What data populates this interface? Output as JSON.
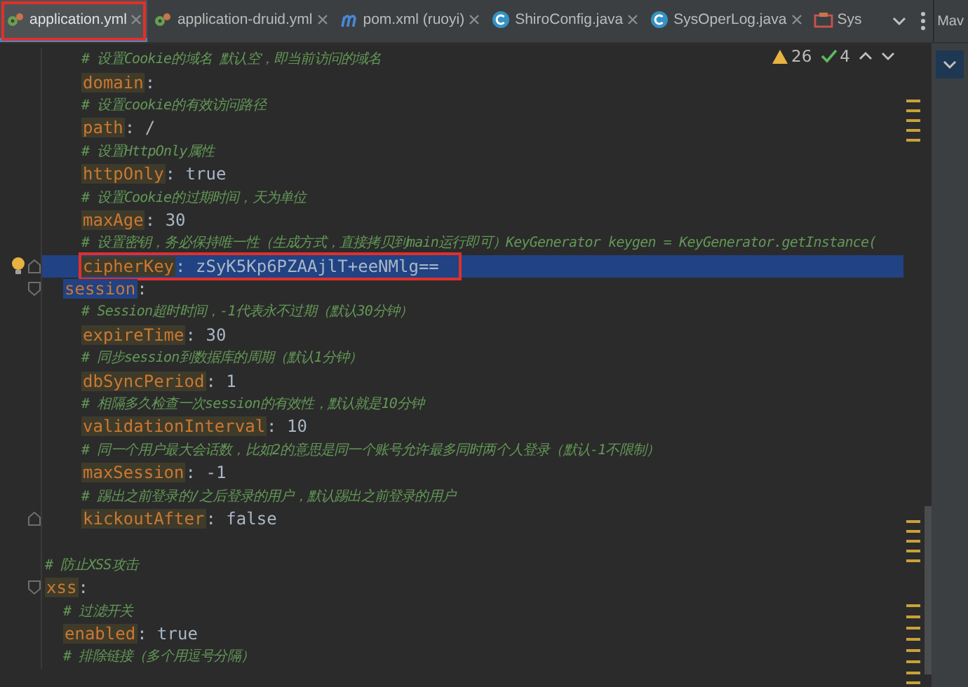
{
  "tabs": [
    {
      "label": "application.yml",
      "kind": "yaml",
      "selected": true,
      "closable": true,
      "outlined": true
    },
    {
      "label": "application-druid.yml",
      "kind": "yaml",
      "selected": false,
      "closable": true,
      "outlined": false
    },
    {
      "label": "pom.xml (ruoyi)",
      "kind": "maven",
      "selected": false,
      "closable": true,
      "outlined": false
    },
    {
      "label": "ShiroConfig.java",
      "kind": "java",
      "selected": false,
      "closable": true,
      "outlined": false
    },
    {
      "label": "SysOperLog.java",
      "kind": "java",
      "selected": false,
      "closable": true,
      "outlined": false
    },
    {
      "label": "Sys",
      "kind": "module",
      "selected": false,
      "closable": false,
      "outlined": false
    }
  ],
  "side_panel": {
    "label": "Mav"
  },
  "inspections": {
    "warnings": "26",
    "passed": "4"
  },
  "lines": [
    {
      "kind": "nest",
      "children": [
        {
          "kind": "nest",
          "children": [
            {
              "kind": "comment",
              "text": "# 设置Cookie的域名 默认空，即当前访问的域名"
            },
            {
              "kind": "pair",
              "key": "domain",
              "separator": ":",
              "selected": false,
              "outlined": false
            },
            {
              "kind": "comment",
              "text": "# 设置cookie的有效访问路径"
            },
            {
              "kind": "pair",
              "key": "path",
              "separator": ":",
              "value": "/",
              "selected": false,
              "outlined": false
            },
            {
              "kind": "comment",
              "text": "# 设置HttpOnly属性"
            },
            {
              "kind": "pair",
              "key": "httpOnly",
              "separator": ":",
              "value": "true",
              "selected": false,
              "outlined": false
            },
            {
              "kind": "comment",
              "text": "# 设置Cookie的过期时间，天为单位"
            },
            {
              "kind": "pair",
              "key": "maxAge",
              "separator": ":",
              "value": "30",
              "selected": false,
              "outlined": false
            },
            {
              "kind": "comment",
              "text": "# 设置密钥，务必保持唯一性（生成方式，直接拷贝到main运行即可）KeyGenerator keygen = KeyGenerator.getInstance("
            },
            {
              "kind": "pair",
              "key": "cipherKey",
              "separator": ":",
              "value": "zSyK5Kp6PZAAjlT+eeNMlg==",
              "selected": true,
              "bulb": true,
              "outlined": true
            }
          ]
        },
        {
          "kind": "pair",
          "key": "session",
          "separator": ":",
          "selected": true,
          "outlined": false,
          "children": [
            {
              "kind": "comment",
              "text": "# Session超时时间，-1代表永不过期（默认30分钟）"
            },
            {
              "kind": "pair",
              "key": "expireTime",
              "separator": ":",
              "value": "30",
              "selected": false,
              "outlined": false
            },
            {
              "kind": "comment",
              "text": "# 同步session到数据库的周期（默认1分钟）"
            },
            {
              "kind": "pair",
              "key": "dbSyncPeriod",
              "separator": ":",
              "value": "1",
              "selected": false,
              "outlined": false
            },
            {
              "kind": "comment",
              "text": "# 相隔多久检查一次session的有效性，默认就是10分钟"
            },
            {
              "kind": "pair",
              "key": "validationInterval",
              "separator": ":",
              "value": "10",
              "selected": false,
              "outlined": false
            },
            {
              "kind": "comment",
              "text": "# 同一个用户最大会话数，比如2的意思是同一个账号允许最多同时两个人登录（默认-1不限制）"
            },
            {
              "kind": "pair",
              "key": "maxSession",
              "separator": ":",
              "value": "-1",
              "selected": false,
              "outlined": false
            },
            {
              "kind": "comment",
              "text": "# 踢出之前登录的/之后登录的用户，默认踢出之前登录的用户"
            },
            {
              "kind": "pair",
              "key": "kickoutAfter",
              "separator": ":",
              "value": "false",
              "selected": false,
              "outlined": false
            }
          ]
        }
      ]
    },
    {
      "kind": "blank"
    },
    {
      "kind": "comment",
      "text": "# 防止XSS攻击"
    },
    {
      "kind": "pair",
      "key": "xss",
      "separator": ":",
      "selected": false,
      "outlined": false,
      "children": [
        {
          "kind": "comment",
          "text": "# 过滤开关"
        },
        {
          "kind": "pair",
          "key": "enabled",
          "separator": ":",
          "value": "true",
          "selected": false,
          "outlined": false
        },
        {
          "kind": "comment",
          "text": "# 排除链接（多个用逗号分隔）"
        }
      ]
    }
  ]
}
